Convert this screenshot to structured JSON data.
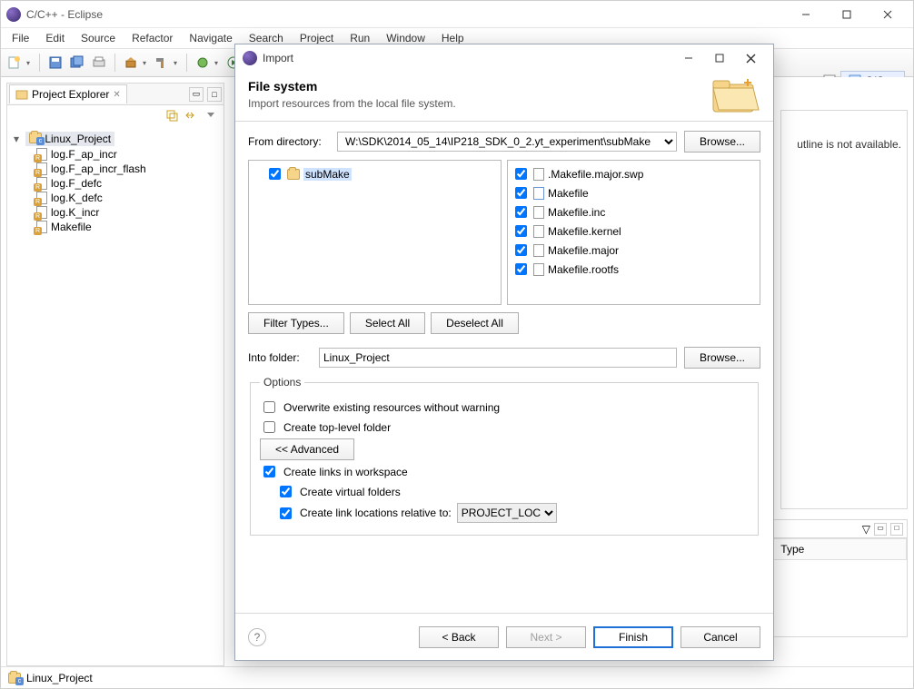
{
  "window": {
    "title": "C/C++ - Eclipse"
  },
  "menu": [
    "File",
    "Edit",
    "Source",
    "Refactor",
    "Navigate",
    "Search",
    "Project",
    "Run",
    "Window",
    "Help"
  ],
  "perspective": {
    "label": "C/C++"
  },
  "projectExplorer": {
    "tabTitle": "Project Explorer",
    "project": "Linux_Project",
    "items": [
      "log.F_ap_incr",
      "log.F_ap_incr_flash",
      "log.F_defc",
      "log.K_defc",
      "log.K_incr",
      "Makefile"
    ]
  },
  "outline": {
    "message": "utline is not available."
  },
  "bottomTable": {
    "cols": [
      "",
      "Type"
    ]
  },
  "status": {
    "project": "Linux_Project"
  },
  "dialog": {
    "title": "Import",
    "heading": "File system",
    "subheading": "Import resources from the local file system.",
    "fromDirLabel": "From directory:",
    "fromDirValue": "W:\\SDK\\2014_05_14\\IP218_SDK_0_2.yt_experiment\\subMake",
    "browse": "Browse...",
    "leftTree": {
      "folder": "subMake"
    },
    "rightFiles": [
      ".Makefile.major.swp",
      "Makefile",
      "Makefile.inc",
      "Makefile.kernel",
      "Makefile.major",
      "Makefile.rootfs"
    ],
    "filterTypes": "Filter Types...",
    "selectAll": "Select All",
    "deselectAll": "Deselect All",
    "intoFolderLabel": "Into folder:",
    "intoFolderValue": "Linux_Project",
    "options": {
      "legend": "Options",
      "overwrite": "Overwrite existing resources without warning",
      "topLevel": "Create top-level folder",
      "advanced": "<< Advanced",
      "createLinks": "Create links in workspace",
      "virtualFolders": "Create virtual folders",
      "relativeTo": "Create link locations relative to:",
      "relativeValue": "PROJECT_LOC"
    },
    "buttons": {
      "back": "< Back",
      "next": "Next >",
      "finish": "Finish",
      "cancel": "Cancel"
    }
  }
}
